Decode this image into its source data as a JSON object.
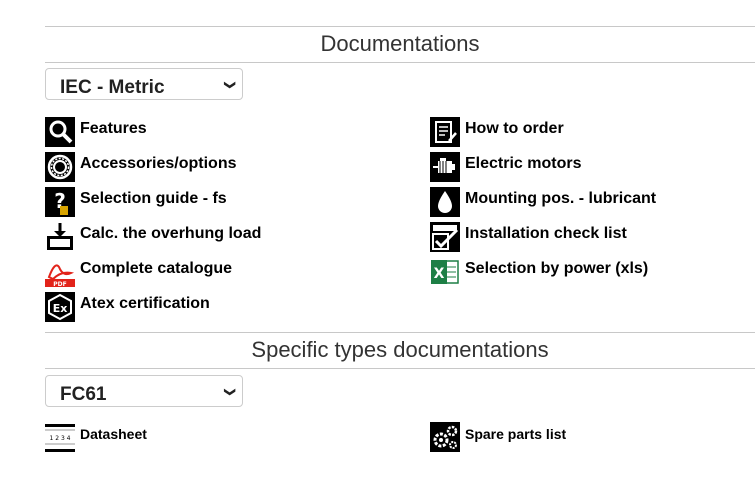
{
  "documentations": {
    "title": "Documentations",
    "select_value": "IEC - Metric",
    "items_left": [
      {
        "label": "Features",
        "icon": "magnifier-icon"
      },
      {
        "label": "Accessories/options",
        "icon": "bearing-icon"
      },
      {
        "label": "Selection guide - fs",
        "icon": "question-icon"
      },
      {
        "label": "Calc. the overhung load",
        "icon": "load-icon"
      },
      {
        "label": "Complete catalogue",
        "icon": "pdf-icon"
      },
      {
        "label": "Atex certification",
        "icon": "atex-icon"
      }
    ],
    "items_right": [
      {
        "label": "How to order",
        "icon": "order-list-icon"
      },
      {
        "label": "Electric motors",
        "icon": "motor-icon"
      },
      {
        "label": "Mounting pos. - lubricant",
        "icon": "oil-drop-icon"
      },
      {
        "label": "Installation check list",
        "icon": "checklist-icon"
      },
      {
        "label": "Selection by power (xls)",
        "icon": "excel-icon"
      }
    ]
  },
  "specific": {
    "title": "Specific types documentations",
    "select_value": "FC61",
    "items_left": [
      {
        "label": "Datasheet",
        "icon": "datasheet-icon"
      }
    ],
    "items_right": [
      {
        "label": "Spare parts list",
        "icon": "gears-icon"
      }
    ]
  }
}
